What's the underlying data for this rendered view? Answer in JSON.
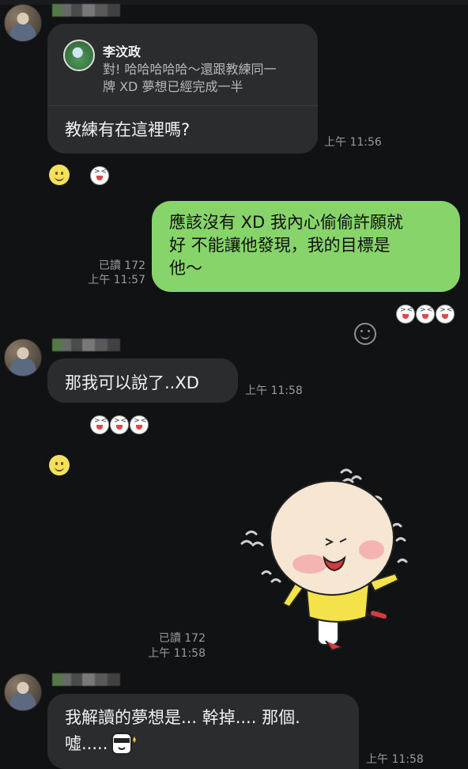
{
  "messages": {
    "m1": {
      "reply": {
        "author": "李汶政",
        "quoted_line1": "對! 哈哈哈哈哈～還跟教練同一",
        "quoted_line2": "牌 XD 夢想已經完成一半"
      },
      "text": "教練有在這裡嗎?",
      "time": "上午 11:56"
    },
    "m2": {
      "line1": "應該沒有 XD 我內心偷偷許願就",
      "line2": "好 不能讓他發現，我的目標是",
      "line3": "他～",
      "read": "已讀 172",
      "time": "上午 11:57"
    },
    "m3": {
      "text": "那我可以說了..XD",
      "time": "上午 11:58"
    },
    "m4": {
      "read": "已讀 172",
      "time": "上午 11:58"
    },
    "m5": {
      "line1": "我解讀的夢想是... 幹掉.... 那個.",
      "line2": "噓.....",
      "time": "上午 11:58"
    }
  },
  "colors": {
    "background": "#111214",
    "incoming_bubble": "#2b2c2e",
    "outgoing_bubble": "#86d46a",
    "timestamp": "#9a9a9a"
  },
  "icons": {
    "reaction_add": "smile-face-icon",
    "reaction_emoji": "laughing-face-icon",
    "sticker": "bald-baby-sticker",
    "emoticon": "shy-emoticon-icon"
  }
}
